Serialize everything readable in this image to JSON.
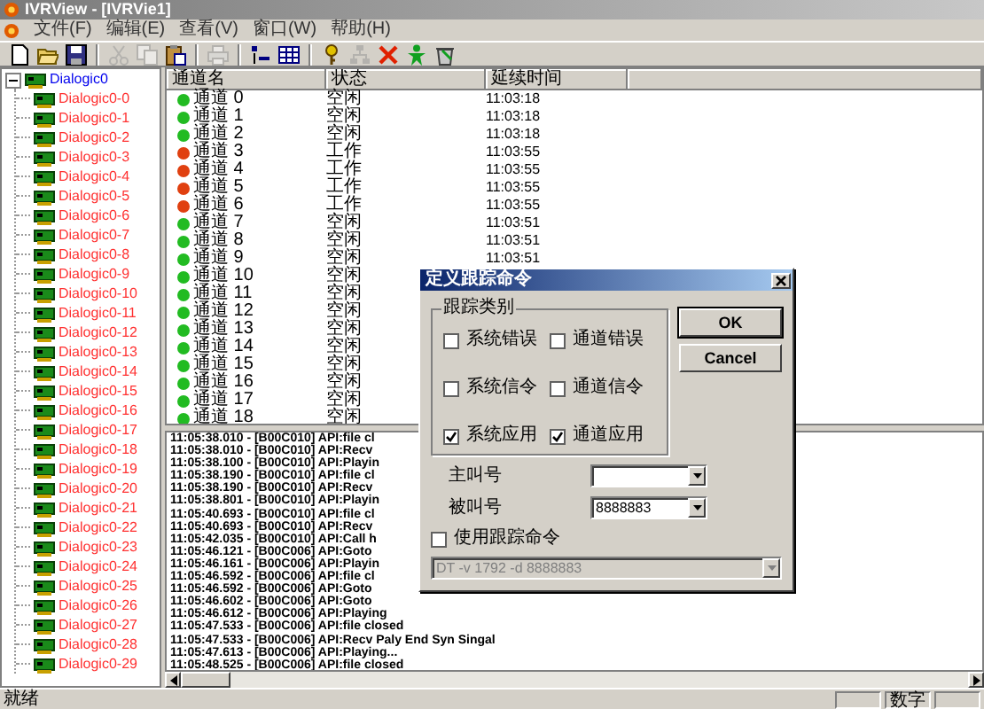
{
  "window": {
    "title": "IVRView - [IVRVie1]"
  },
  "menu": [
    "文件(F)",
    "编辑(E)",
    "查看(V)",
    "窗口(W)",
    "帮助(H)"
  ],
  "toolbar": [
    {
      "kind": "new",
      "disabled": false
    },
    {
      "kind": "open",
      "disabled": false
    },
    {
      "kind": "save",
      "disabled": false
    },
    {
      "kind": "separator"
    },
    {
      "kind": "cut",
      "disabled": true
    },
    {
      "kind": "copy",
      "disabled": true
    },
    {
      "kind": "paste",
      "disabled": false
    },
    {
      "kind": "separator"
    },
    {
      "kind": "print",
      "disabled": true
    },
    {
      "kind": "separator"
    },
    {
      "kind": "sort",
      "disabled": false
    },
    {
      "kind": "grid",
      "disabled": false
    },
    {
      "kind": "separator"
    },
    {
      "kind": "key",
      "disabled": false
    },
    {
      "kind": "network",
      "disabled": true
    },
    {
      "kind": "delete",
      "disabled": false
    },
    {
      "kind": "person",
      "disabled": false
    },
    {
      "kind": "trash",
      "disabled": false
    }
  ],
  "tree": {
    "label": "Dialogic0",
    "expanded": true,
    "children": [
      {
        "label": "Dialogic0-0"
      },
      {
        "label": "Dialogic0-1"
      },
      {
        "label": "Dialogic0-2"
      },
      {
        "label": "Dialogic0-3"
      },
      {
        "label": "Dialogic0-4"
      },
      {
        "label": "Dialogic0-5"
      },
      {
        "label": "Dialogic0-6"
      },
      {
        "label": "Dialogic0-7"
      },
      {
        "label": "Dialogic0-8"
      },
      {
        "label": "Dialogic0-9"
      },
      {
        "label": "Dialogic0-10"
      },
      {
        "label": "Dialogic0-11"
      },
      {
        "label": "Dialogic0-12"
      },
      {
        "label": "Dialogic0-13"
      },
      {
        "label": "Dialogic0-14"
      },
      {
        "label": "Dialogic0-15"
      },
      {
        "label": "Dialogic0-16"
      },
      {
        "label": "Dialogic0-17"
      },
      {
        "label": "Dialogic0-18"
      },
      {
        "label": "Dialogic0-19"
      },
      {
        "label": "Dialogic0-20"
      },
      {
        "label": "Dialogic0-21"
      },
      {
        "label": "Dialogic0-22"
      },
      {
        "label": "Dialogic0-23"
      },
      {
        "label": "Dialogic0-24"
      },
      {
        "label": "Dialogic0-25"
      },
      {
        "label": "Dialogic0-26"
      },
      {
        "label": "Dialogic0-27"
      },
      {
        "label": "Dialogic0-28"
      },
      {
        "label": "Dialogic0-29"
      }
    ]
  },
  "channel_table": {
    "columns": [
      "通道名",
      "状态",
      "延续时间"
    ],
    "rows": [
      {
        "name": "通道 0",
        "status": "空闲",
        "time": "11:03:18",
        "color": "#22bb22"
      },
      {
        "name": "通道 1",
        "status": "空闲",
        "time": "11:03:18",
        "color": "#22bb22"
      },
      {
        "name": "通道 2",
        "status": "空闲",
        "time": "11:03:18",
        "color": "#22bb22"
      },
      {
        "name": "通道 3",
        "status": "工作",
        "time": "11:03:55",
        "color": "#e04010"
      },
      {
        "name": "通道 4",
        "status": "工作",
        "time": "11:03:55",
        "color": "#e04010"
      },
      {
        "name": "通道 5",
        "status": "工作",
        "time": "11:03:55",
        "color": "#e04010"
      },
      {
        "name": "通道 6",
        "status": "工作",
        "time": "11:03:55",
        "color": "#e04010"
      },
      {
        "name": "通道 7",
        "status": "空闲",
        "time": "11:03:51",
        "color": "#22bb22"
      },
      {
        "name": "通道 8",
        "status": "空闲",
        "time": "11:03:51",
        "color": "#22bb22"
      },
      {
        "name": "通道 9",
        "status": "空闲",
        "time": "11:03:51",
        "color": "#22bb22"
      },
      {
        "name": "通道 10",
        "status": "空闲",
        "color": "#22bb22"
      },
      {
        "name": "通道 11",
        "status": "空闲",
        "color": "#22bb22"
      },
      {
        "name": "通道 12",
        "status": "空闲",
        "color": "#22bb22"
      },
      {
        "name": "通道 13",
        "status": "空闲",
        "color": "#22bb22"
      },
      {
        "name": "通道 14",
        "status": "空闲",
        "color": "#22bb22"
      },
      {
        "name": "通道 15",
        "status": "空闲",
        "color": "#22bb22"
      },
      {
        "name": "通道 16",
        "status": "空闲",
        "color": "#22bb22"
      },
      {
        "name": "通道 17",
        "status": "空闲",
        "color": "#22bb22"
      },
      {
        "name": "通道 18",
        "status": "空闲",
        "color": "#22bb22"
      }
    ]
  },
  "log": [
    "11:05:38.010 - [B00C010] API:file cl",
    "11:05:38.010 - [B00C010] API:Recv",
    "11:05:38.100 - [B00C010] API:Playin",
    "11:05:38.190 - [B00C010] API:file cl",
    "11:05:38.190 - [B00C010] API:Recv",
    "11:05:38.801 - [B00C010] API:Playin",
    "11:05:40.693 - [B00C010] API:file cl",
    "11:05:40.693 - [B00C010] API:Recv",
    "11:05:42.035 - [B00C010] API:Call h",
    "11:05:46.121 - [B00C006] API:Goto",
    "11:05:46.161 - [B00C006] API:Playin",
    "11:05:46.592 - [B00C006] API:file cl",
    "11:05:46.592 - [B00C006] API:Goto",
    "11:05:46.602 - [B00C006] API:Goto",
    "11:05:46.612 - [B00C006] API:Playing",
    "11:05:47.533 - [B00C006] API:file closed",
    "11:05:47.533 - [B00C006] API:Recv Paly End Syn Singal",
    "11:05:47.613 - [B00C006] API:Playing...",
    "11:05:48.525 - [B00C006] API:file closed"
  ],
  "dialog": {
    "title": "定义跟踪命令",
    "group": {
      "label": "跟踪类别",
      "options": [
        {
          "label": "系统错误",
          "checked": false
        },
        {
          "label": "通道错误",
          "checked": false
        },
        {
          "label": "系统信令",
          "checked": false
        },
        {
          "label": "通道信令",
          "checked": false
        },
        {
          "label": "系统应用",
          "checked": true
        },
        {
          "label": "通道应用",
          "checked": true
        }
      ]
    },
    "buttons": [
      "OK",
      "Cancel"
    ],
    "fields": [
      {
        "label": "主叫号"
      },
      {
        "label": "被叫号",
        "value": "8888883"
      }
    ],
    "use_command": {
      "label": "使用跟踪命令",
      "checked": false
    },
    "command": {
      "value": "DT -v 1792 -d 8888883",
      "disabled": true
    }
  },
  "status_bar": {
    "text": "就绪",
    "indicators": [
      "数字"
    ]
  }
}
